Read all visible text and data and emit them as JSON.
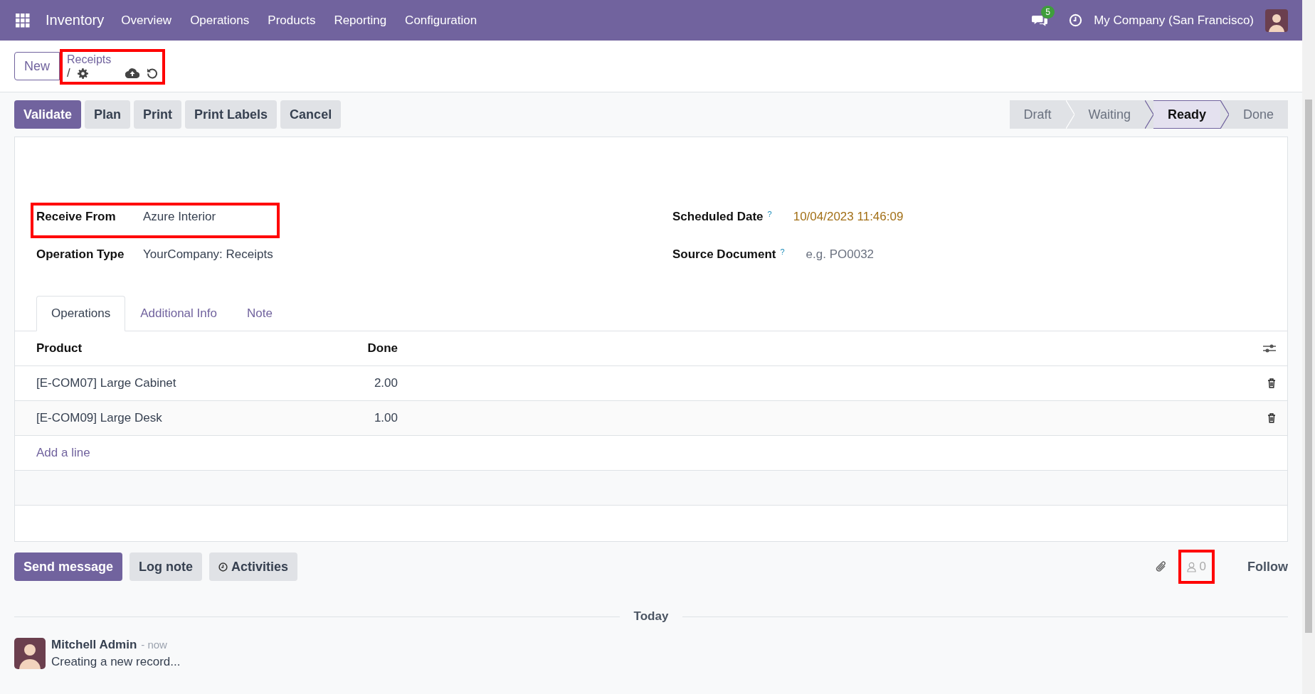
{
  "navbar": {
    "app_name": "Inventory",
    "menu": [
      "Overview",
      "Operations",
      "Products",
      "Reporting",
      "Configuration"
    ],
    "messages_badge": "5",
    "company": "My Company (San Francisco)"
  },
  "control_panel": {
    "new_button": "New",
    "breadcrumb": "Receipts",
    "separator": "/",
    "highlighted": true
  },
  "actions": [
    {
      "label": "Validate",
      "primary": true
    },
    {
      "label": "Plan",
      "primary": false
    },
    {
      "label": "Print",
      "primary": false
    },
    {
      "label": "Print Labels",
      "primary": false
    },
    {
      "label": "Cancel",
      "primary": false
    }
  ],
  "statusbar": [
    {
      "label": "Draft",
      "selected": false
    },
    {
      "label": "Waiting",
      "selected": false
    },
    {
      "label": "Ready",
      "selected": true
    },
    {
      "label": "Done",
      "selected": false
    }
  ],
  "fields_left": [
    {
      "label": "Receive From",
      "value": "Azure Interior",
      "highlighted": true
    },
    {
      "label": "Operation Type",
      "value": "YourCompany: Receipts",
      "highlighted": false
    }
  ],
  "fields_right": [
    {
      "label": "Scheduled Date",
      "help": "?",
      "kind": "date",
      "value": "10/04/2023 11:46:09"
    },
    {
      "label": "Source Document",
      "help": "?",
      "kind": "input",
      "placeholder": "e.g. PO0032"
    }
  ],
  "tabs": [
    {
      "label": "Operations",
      "selected": true
    },
    {
      "label": "Additional Info",
      "selected": false
    },
    {
      "label": "Note",
      "selected": false
    }
  ],
  "table": {
    "columns": [
      "Product",
      "Done"
    ],
    "rows": [
      {
        "product": "[E-COM07] Large Cabinet",
        "done": "2.00"
      },
      {
        "product": "[E-COM09] Large Desk",
        "done": "1.00"
      }
    ],
    "add_line": "Add a line"
  },
  "chatter": {
    "buttons": [
      {
        "label": "Send message",
        "kind": "send"
      },
      {
        "label": "Log note",
        "kind": "note"
      },
      {
        "label": "Activities",
        "kind": "activities"
      }
    ],
    "followers_count": "0",
    "followers_highlighted": true,
    "follow": "Follow",
    "date_separator": "Today",
    "messages": [
      {
        "author": "Mitchell Admin",
        "time": "- now",
        "body": "Creating a new record..."
      }
    ]
  }
}
